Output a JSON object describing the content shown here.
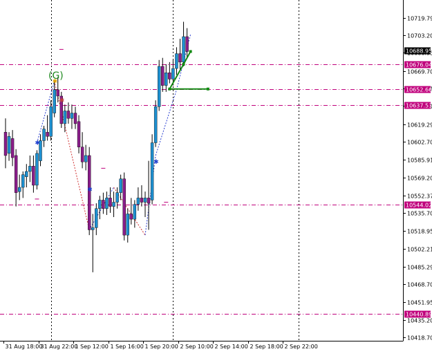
{
  "chart_data": {
    "type": "candlestick",
    "symbol_note": "",
    "y_axis": {
      "min": 10418.7,
      "max": 10730.0,
      "ticks": [
        10719.79,
        10703.2,
        10686.95,
        10669.7,
        10653.21,
        10636.71,
        10619.29,
        10602.7,
        10585.91,
        10569.2,
        10552.37,
        10535.7,
        10518.95,
        10502.21,
        10485.29,
        10468.7,
        10451.95,
        10435.2,
        10418.7
      ],
      "tick_labels": [
        "10719.79",
        "10703.20",
        "10686.95",
        "10669.70",
        "10653.21",
        "10636.71",
        "10619.29",
        "10602.70",
        "10585.91",
        "10569.20",
        "10552.37",
        "10535.70",
        "10518.95",
        "10502.21",
        "10485.29",
        "10468.70",
        "10451.95",
        "10435.20",
        "10418.70"
      ]
    },
    "x_axis": {
      "tick_labels": [
        "31 Aug 18:00",
        "31 Aug 22:00",
        "1 Sep 12:00",
        "1 Sep 16:00",
        "1 Sep 20:00",
        "2 Sep 10:00",
        "2 Sep 14:00",
        "2 Sep 18:00",
        "2 Sep 22:00"
      ],
      "tick_bar_index": [
        0,
        10,
        20,
        30,
        40,
        50,
        60,
        70,
        80
      ]
    },
    "vertical_grid_bar_index": [
      13,
      48,
      84
    ],
    "levels": [
      {
        "value": 10676.04,
        "label": "10676.04",
        "color": "#c0007c"
      },
      {
        "value": 10652.66,
        "label": "10652.66",
        "color": "#c0007c"
      },
      {
        "value": 10637.53,
        "label": "10637.53",
        "color": "#c0007c"
      },
      {
        "value": 10544.02,
        "label": "10544.02",
        "color": "#c0007c"
      },
      {
        "value": 10440.89,
        "label": "10440.89",
        "color": "#c0007c"
      }
    ],
    "current_price": {
      "value": 10688.95,
      "label": "10688.95"
    },
    "pattern_label": "(G)",
    "candles": [
      [
        10612,
        10625,
        10578,
        10590
      ],
      [
        10592,
        10612,
        10585,
        10608
      ],
      [
        10606,
        10614,
        10580,
        10588
      ],
      [
        10590,
        10596,
        10542,
        10555
      ],
      [
        10556,
        10572,
        10548,
        10560
      ],
      [
        10560,
        10575,
        10550,
        10572
      ],
      [
        10570,
        10582,
        10560,
        10575
      ],
      [
        10575,
        10590,
        10565,
        10580
      ],
      [
        10580,
        10590,
        10555,
        10562
      ],
      [
        10562,
        10595,
        10558,
        10592
      ],
      [
        10585,
        10610,
        10580,
        10604
      ],
      [
        10604,
        10618,
        10598,
        10615
      ],
      [
        10612,
        10628,
        10604,
        10608
      ],
      [
        10608,
        10642,
        10604,
        10636
      ],
      [
        10630,
        10660,
        10626,
        10652
      ],
      [
        10652,
        10664,
        10640,
        10646
      ],
      [
        10646,
        10650,
        10616,
        10620
      ],
      [
        10620,
        10638,
        10612,
        10632
      ],
      [
        10632,
        10640,
        10620,
        10625
      ],
      [
        10625,
        10638,
        10615,
        10630
      ],
      [
        10630,
        10636,
        10615,
        10620
      ],
      [
        10622,
        10628,
        10592,
        10598
      ],
      [
        10598,
        10612,
        10578,
        10584
      ],
      [
        10584,
        10600,
        10576,
        10590
      ],
      [
        10590,
        10598,
        10515,
        10520
      ],
      [
        10520,
        10535,
        10480,
        10522
      ],
      [
        10522,
        10545,
        10515,
        10540
      ],
      [
        10540,
        10552,
        10530,
        10548
      ],
      [
        10548,
        10555,
        10535,
        10540
      ],
      [
        10540,
        10556,
        10534,
        10550
      ],
      [
        10550,
        10560,
        10536,
        10542
      ],
      [
        10542,
        10556,
        10532,
        10546
      ],
      [
        10546,
        10560,
        10540,
        10555
      ],
      [
        10555,
        10572,
        10548,
        10568
      ],
      [
        10568,
        10574,
        10510,
        10515
      ],
      [
        10515,
        10540,
        10508,
        10535
      ],
      [
        10535,
        10550,
        10525,
        10530
      ],
      [
        10530,
        10548,
        10522,
        10544
      ],
      [
        10544,
        10560,
        10538,
        10550
      ],
      [
        10550,
        10562,
        10542,
        10546
      ],
      [
        10546,
        10556,
        10532,
        10550
      ],
      [
        10550,
        10585,
        10520,
        10545
      ],
      [
        10548,
        10610,
        10544,
        10602
      ],
      [
        10602,
        10642,
        10598,
        10636
      ],
      [
        10636,
        10680,
        10632,
        10674
      ],
      [
        10674,
        10682,
        10650,
        10656
      ],
      [
        10656,
        10676,
        10650,
        10668
      ],
      [
        10668,
        10678,
        10658,
        10662
      ],
      [
        10662,
        10680,
        10656,
        10672
      ],
      [
        10672,
        10692,
        10666,
        10686
      ],
      [
        10686,
        10700,
        10670,
        10678
      ],
      [
        10678,
        10716,
        10674,
        10702
      ],
      [
        10702,
        10710,
        10682,
        10688
      ]
    ],
    "zigzag": [
      [
        9,
        10602
      ],
      [
        14,
        10660
      ],
      [
        24,
        10520
      ],
      [
        31,
        10560
      ],
      [
        40,
        10515
      ],
      [
        43,
        10590
      ],
      [
        49,
        10652
      ],
      [
        53,
        10704
      ]
    ],
    "markers": [
      {
        "bar": 9,
        "value": 10602,
        "color": "#1f3fcf",
        "shape": "star"
      },
      {
        "bar": 14,
        "value": 10660,
        "color": "#e0a000",
        "shape": "star"
      },
      {
        "bar": 16,
        "value": 10642,
        "color": "#c04040",
        "shape": "star"
      },
      {
        "bar": 24,
        "value": 10558,
        "color": "#1f3fcf",
        "shape": "star"
      },
      {
        "bar": 43,
        "value": 10584,
        "color": "#1f3fcf",
        "shape": "star"
      }
    ],
    "green_pattern": {
      "points": [
        [
          47,
          10652.66
        ],
        [
          51,
          10676
        ],
        [
          53,
          10688
        ]
      ],
      "base": [
        [
          47,
          10652.66
        ],
        [
          58,
          10652.66
        ]
      ],
      "color": "#138a13"
    },
    "small_marks": [
      {
        "bar": 16,
        "value": 10690,
        "color": "#c0007c"
      },
      {
        "bar": 28,
        "value": 10578,
        "color": "#c0007c"
      },
      {
        "bar": 9,
        "value": 10549,
        "color": "#c0007c"
      },
      {
        "bar": 46,
        "value": 10546,
        "color": "#c0007c"
      }
    ],
    "colors": {
      "bull": "#1e90d0",
      "bear": "#8a1d8a",
      "wick": "#000000",
      "grid": "#000000",
      "level": "#c0007c",
      "level_label_bg": "#c0007c",
      "current_label_bg": "#000000"
    }
  }
}
